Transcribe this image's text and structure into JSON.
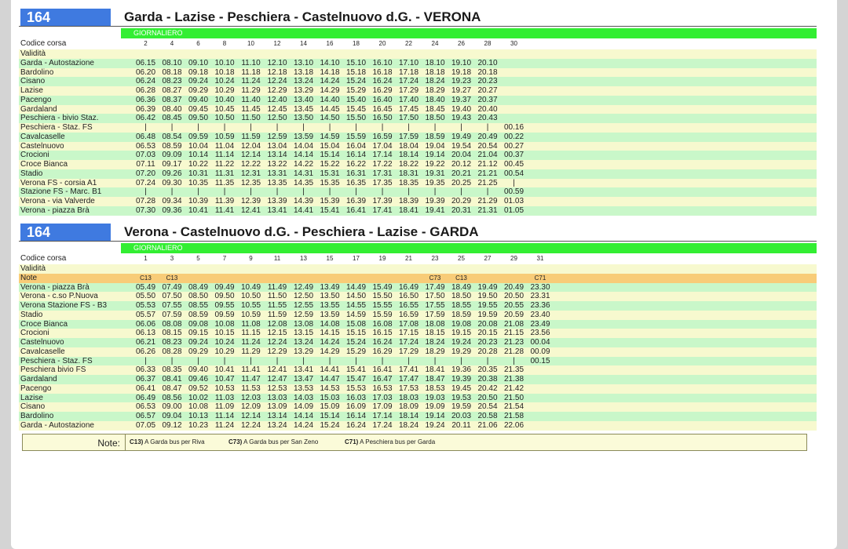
{
  "outbound": {
    "route": "164",
    "title": "Garda - Lazise - Peschiera - Castelnuovo d.G. - VERONA",
    "band": "GIORNALIERO",
    "codice_label": "Codice corsa",
    "validita_label": "Validità",
    "codes": [
      "2",
      "4",
      "6",
      "8",
      "10",
      "12",
      "14",
      "16",
      "18",
      "20",
      "22",
      "24",
      "26",
      "28",
      "30"
    ],
    "stops": [
      {
        "name": "Garda - Autostazione",
        "times": [
          "06.15",
          "08.10",
          "09.10",
          "10.10",
          "11.10",
          "12.10",
          "13.10",
          "14.10",
          "15.10",
          "16.10",
          "17.10",
          "18.10",
          "19.10",
          "20.10",
          ""
        ]
      },
      {
        "name": "Bardolino",
        "times": [
          "06.20",
          "08.18",
          "09.18",
          "10.18",
          "11.18",
          "12.18",
          "13.18",
          "14.18",
          "15.18",
          "16.18",
          "17.18",
          "18.18",
          "19.18",
          "20.18",
          ""
        ]
      },
      {
        "name": "Cisano",
        "times": [
          "06.24",
          "08.23",
          "09.24",
          "10.24",
          "11.24",
          "12.24",
          "13.24",
          "14.24",
          "15.24",
          "16.24",
          "17.24",
          "18.24",
          "19.23",
          "20.23",
          ""
        ]
      },
      {
        "name": "Lazise",
        "times": [
          "06.28",
          "08.27",
          "09.29",
          "10.29",
          "11.29",
          "12.29",
          "13.29",
          "14.29",
          "15.29",
          "16.29",
          "17.29",
          "18.29",
          "19.27",
          "20.27",
          ""
        ]
      },
      {
        "name": "Pacengo",
        "times": [
          "06.36",
          "08.37",
          "09.40",
          "10.40",
          "11.40",
          "12.40",
          "13.40",
          "14.40",
          "15.40",
          "16.40",
          "17.40",
          "18.40",
          "19.37",
          "20.37",
          ""
        ]
      },
      {
        "name": "Gardaland",
        "times": [
          "06.39",
          "08.40",
          "09.45",
          "10.45",
          "11.45",
          "12.45",
          "13.45",
          "14.45",
          "15.45",
          "16.45",
          "17.45",
          "18.45",
          "19.40",
          "20.40",
          ""
        ]
      },
      {
        "name": "Peschiera - bivio Staz.",
        "times": [
          "06.42",
          "08.45",
          "09.50",
          "10.50",
          "11.50",
          "12.50",
          "13.50",
          "14.50",
          "15.50",
          "16.50",
          "17.50",
          "18.50",
          "19.43",
          "20.43",
          ""
        ]
      },
      {
        "name": "Peschiera - Staz. FS",
        "times": [
          "|",
          "|",
          "|",
          "|",
          "|",
          "|",
          "|",
          "|",
          "|",
          "|",
          "|",
          "|",
          "|",
          "|",
          "00.16"
        ]
      },
      {
        "name": "Cavalcaselle",
        "times": [
          "06.48",
          "08.54",
          "09.59",
          "10.59",
          "11.59",
          "12.59",
          "13.59",
          "14.59",
          "15.59",
          "16.59",
          "17.59",
          "18.59",
          "19.49",
          "20.49",
          "00.22"
        ]
      },
      {
        "name": "Castelnuovo",
        "times": [
          "06.53",
          "08.59",
          "10.04",
          "11.04",
          "12.04",
          "13.04",
          "14.04",
          "15.04",
          "16.04",
          "17.04",
          "18.04",
          "19.04",
          "19.54",
          "20.54",
          "00.27"
        ]
      },
      {
        "name": "Crocioni",
        "times": [
          "07.03",
          "09.09",
          "10.14",
          "11.14",
          "12.14",
          "13.14",
          "14.14",
          "15.14",
          "16.14",
          "17.14",
          "18.14",
          "19.14",
          "20.04",
          "21.04",
          "00.37"
        ]
      },
      {
        "name": "Croce Bianca",
        "times": [
          "07.11",
          "09.17",
          "10.22",
          "11.22",
          "12.22",
          "13.22",
          "14.22",
          "15.22",
          "16.22",
          "17.22",
          "18.22",
          "19.22",
          "20.12",
          "21.12",
          "00.45"
        ]
      },
      {
        "name": "Stadio",
        "times": [
          "07.20",
          "09.26",
          "10.31",
          "11.31",
          "12.31",
          "13.31",
          "14.31",
          "15.31",
          "16.31",
          "17.31",
          "18.31",
          "19.31",
          "20.21",
          "21.21",
          "00.54"
        ]
      },
      {
        "name": "Verona FS - corsia A1",
        "times": [
          "07.24",
          "09.30",
          "10.35",
          "11.35",
          "12.35",
          "13.35",
          "14.35",
          "15.35",
          "16.35",
          "17.35",
          "18.35",
          "19.35",
          "20.25",
          "21.25",
          "|"
        ]
      },
      {
        "name": "Stazione FS - Marc. B1",
        "times": [
          "|",
          "|",
          "|",
          "|",
          "|",
          "|",
          "|",
          "|",
          "|",
          "|",
          "|",
          "|",
          "|",
          "|",
          "00.59"
        ]
      },
      {
        "name": "Verona - via Valverde",
        "times": [
          "07.28",
          "09.34",
          "10.39",
          "11.39",
          "12.39",
          "13.39",
          "14.39",
          "15.39",
          "16.39",
          "17.39",
          "18.39",
          "19.39",
          "20.29",
          "21.29",
          "01.03"
        ]
      },
      {
        "name": "Verona - piazza Brà",
        "times": [
          "07.30",
          "09.36",
          "10.41",
          "11.41",
          "12.41",
          "13.41",
          "14.41",
          "15.41",
          "16.41",
          "17.41",
          "18.41",
          "19.41",
          "20.31",
          "21.31",
          "01.05"
        ]
      }
    ]
  },
  "return": {
    "route": "164",
    "title": "Verona - Castelnuovo d.G. - Peschiera - Lazise - GARDA",
    "band": "GIORNALIERO",
    "codice_label": "Codice corsa",
    "validita_label": "Validità",
    "note_label": "Note",
    "codes": [
      "1",
      "3",
      "5",
      "7",
      "9",
      "11",
      "13",
      "15",
      "17",
      "19",
      "21",
      "23",
      "25",
      "27",
      "29",
      "31"
    ],
    "notes": [
      "C13",
      "C13",
      "",
      "",
      "",
      "",
      "",
      "",
      "",
      "",
      "",
      "C73",
      "C13",
      "",
      "",
      "C71"
    ],
    "stops": [
      {
        "name": "Verona - piazza Brà",
        "times": [
          "05.49",
          "07.49",
          "08.49",
          "09.49",
          "10.49",
          "11.49",
          "12.49",
          "13.49",
          "14.49",
          "15.49",
          "16.49",
          "17.49",
          "18.49",
          "19.49",
          "20.49",
          "23.30"
        ]
      },
      {
        "name": "Verona - c.so P.Nuova",
        "times": [
          "05.50",
          "07.50",
          "08.50",
          "09.50",
          "10.50",
          "11.50",
          "12.50",
          "13.50",
          "14.50",
          "15.50",
          "16.50",
          "17.50",
          "18.50",
          "19.50",
          "20.50",
          "23.31"
        ]
      },
      {
        "name": "Verona Stazione FS - B3",
        "times": [
          "05.53",
          "07.55",
          "08.55",
          "09.55",
          "10.55",
          "11.55",
          "12.55",
          "13.55",
          "14.55",
          "15.55",
          "16.55",
          "17.55",
          "18.55",
          "19.55",
          "20.55",
          "23.36"
        ]
      },
      {
        "name": "Stadio",
        "times": [
          "05.57",
          "07.59",
          "08.59",
          "09.59",
          "10.59",
          "11.59",
          "12.59",
          "13.59",
          "14.59",
          "15.59",
          "16.59",
          "17.59",
          "18.59",
          "19.59",
          "20.59",
          "23.40"
        ]
      },
      {
        "name": "Croce Bianca",
        "times": [
          "06.06",
          "08.08",
          "09.08",
          "10.08",
          "11.08",
          "12.08",
          "13.08",
          "14.08",
          "15.08",
          "16.08",
          "17.08",
          "18.08",
          "19.08",
          "20.08",
          "21.08",
          "23.49"
        ]
      },
      {
        "name": "Crocioni",
        "times": [
          "06.13",
          "08.15",
          "09.15",
          "10.15",
          "11.15",
          "12.15",
          "13.15",
          "14.15",
          "15.15",
          "16.15",
          "17.15",
          "18.15",
          "19.15",
          "20.15",
          "21.15",
          "23.56"
        ]
      },
      {
        "name": "Castelnuovo",
        "times": [
          "06.21",
          "08.23",
          "09.24",
          "10.24",
          "11.24",
          "12.24",
          "13.24",
          "14.24",
          "15.24",
          "16.24",
          "17.24",
          "18.24",
          "19.24",
          "20.23",
          "21.23",
          "00.04"
        ]
      },
      {
        "name": "Cavalcaselle",
        "times": [
          "06.26",
          "08.28",
          "09.29",
          "10.29",
          "11.29",
          "12.29",
          "13.29",
          "14.29",
          "15.29",
          "16.29",
          "17.29",
          "18.29",
          "19.29",
          "20.28",
          "21.28",
          "00.09"
        ]
      },
      {
        "name": "Peschiera - Staz. FS",
        "times": [
          "|",
          "|",
          "|",
          "|",
          "|",
          "|",
          "|",
          "|",
          "|",
          "|",
          "|",
          "|",
          "|",
          "|",
          "|",
          "00.15"
        ]
      },
      {
        "name": "Peschiera bivio FS",
        "times": [
          "06.33",
          "08.35",
          "09.40",
          "10.41",
          "11.41",
          "12.41",
          "13.41",
          "14.41",
          "15.41",
          "16.41",
          "17.41",
          "18.41",
          "19.36",
          "20.35",
          "21.35",
          ""
        ]
      },
      {
        "name": "Gardaland",
        "times": [
          "06.37",
          "08.41",
          "09.46",
          "10.47",
          "11.47",
          "12.47",
          "13.47",
          "14.47",
          "15.47",
          "16.47",
          "17.47",
          "18.47",
          "19.39",
          "20.38",
          "21.38",
          ""
        ]
      },
      {
        "name": "Pacengo",
        "times": [
          "06.41",
          "08.47",
          "09.52",
          "10.53",
          "11.53",
          "12.53",
          "13.53",
          "14.53",
          "15.53",
          "16.53",
          "17.53",
          "18.53",
          "19.45",
          "20.42",
          "21.42",
          ""
        ]
      },
      {
        "name": "Lazise",
        "times": [
          "06.49",
          "08.56",
          "10.02",
          "11.03",
          "12.03",
          "13.03",
          "14.03",
          "15.03",
          "16.03",
          "17.03",
          "18.03",
          "19.03",
          "19.53",
          "20.50",
          "21.50",
          ""
        ]
      },
      {
        "name": "Cisano",
        "times": [
          "06.53",
          "09.00",
          "10.08",
          "11.09",
          "12.09",
          "13.09",
          "14.09",
          "15.09",
          "16.09",
          "17.09",
          "18.09",
          "19.09",
          "19.59",
          "20.54",
          "21.54",
          ""
        ]
      },
      {
        "name": "Bardolino",
        "times": [
          "06.57",
          "09.04",
          "10.13",
          "11.14",
          "12.14",
          "13.14",
          "14.14",
          "15.14",
          "16.14",
          "17.14",
          "18.14",
          "19.14",
          "20.03",
          "20.58",
          "21.58",
          ""
        ]
      },
      {
        "name": "Garda - Autostazione",
        "times": [
          "07.05",
          "09.12",
          "10.23",
          "11.24",
          "12.24",
          "13.24",
          "14.24",
          "15.24",
          "16.24",
          "17.24",
          "18.24",
          "19.24",
          "20.11",
          "21.06",
          "22.06",
          ""
        ]
      }
    ]
  },
  "note_section": {
    "title": "Note:",
    "items": [
      {
        "code": "C13)",
        "text": "A Garda bus per Riva"
      },
      {
        "code": "C73)",
        "text": "A Garda bus per San Zeno"
      },
      {
        "code": "C71)",
        "text": "A Peschiera bus per Garda"
      }
    ]
  }
}
